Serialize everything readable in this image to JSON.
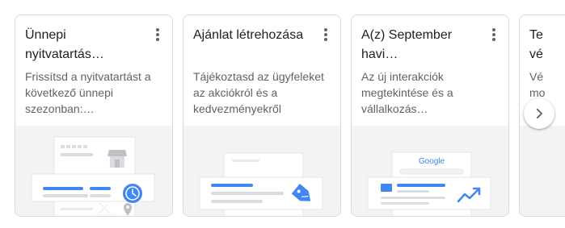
{
  "cards": [
    {
      "title": "Ünnepi\nnyitvatartás…",
      "description": "Frissítsd a nyitvatartást a\nkövetkező ünnepi\nszezonban:…",
      "illustration_icon": "clock-icon"
    },
    {
      "title": "Ajánlat létrehozása",
      "description": "Tájékoztasd az ügyfeleket\naz akciókról és a\nkedvezményekről",
      "illustration_icon": "price-tag-icon"
    },
    {
      "title": "A(z) September\nhavi…",
      "description": "Az új interakciók\nmegtekintése és a\nvállalkozás…",
      "illustration_icon": "trending-up-icon",
      "illustration_brand": "Google"
    },
    {
      "title": "Te\nvé",
      "description": "Vé\nmo"
    }
  ],
  "next_button": {
    "icon": "chevron-right-icon"
  },
  "colors": {
    "accent": "#4285f4",
    "title_text": "#202124",
    "secondary_text": "#5f6368",
    "card_border": "#dadce0",
    "illustration_bg": "#f1f3f4"
  }
}
